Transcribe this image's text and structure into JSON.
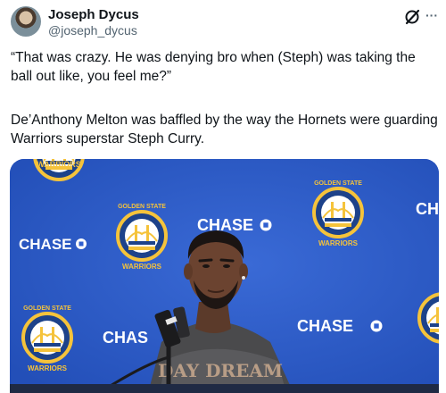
{
  "author": {
    "name": "Joseph Dycus",
    "handle": "@joseph_dycus"
  },
  "icons": {
    "grok": "grok-slash-icon",
    "more": "more-options-icon"
  },
  "tweet": {
    "paragraph_1": "“That was crazy. He was denying bro when (Steph) was taking the ball out like, you feel me?”",
    "paragraph_2": "De’Anthony Melton was baffled by the way the Hornets were guarding Warriors superstar Steph Curry."
  },
  "media": {
    "backdrop_sponsor_text": "CHASE",
    "backdrop_sponsor_partial_1": "CHAS",
    "backdrop_sponsor_partial_2": "CH",
    "logo_top_text": "GOLDEN STATE",
    "logo_bottom_text": "WARRIORS",
    "logo_bottom_partial": "WARRIOR",
    "shirt_text": "DAY DREAM",
    "colors": {
      "backdrop_blue": "#2f5fcf",
      "warriors_gold": "#f5c33b",
      "warriors_blue": "#1d428a"
    }
  }
}
